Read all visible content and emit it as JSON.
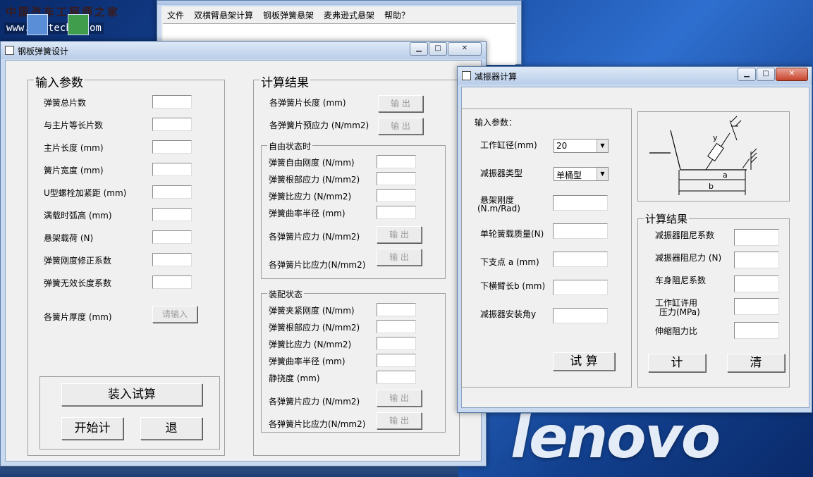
{
  "desktop": {
    "watermark_cn": "中国汽车工程师之家",
    "watermark_url": "www.cartech8.com",
    "brand": "lenovo"
  },
  "main_window": {
    "menu": [
      "文件",
      "双横臂悬架计算",
      "钢板弹簧悬架",
      "麦弗逊式悬架",
      "帮助？"
    ]
  },
  "leaf_spring": {
    "title": "钢板弹簧设计",
    "title_buttons": {
      "min": "▁",
      "max": "□",
      "close": "✕"
    },
    "input_group": {
      "label": "输入参数",
      "fields": [
        "弹簧总片数",
        "与主片等长片数",
        "主片长度    (mm)",
        "簧片宽度    (mm)",
        "U型螺栓加紧距 (mm)",
        "满载时弧高 (mm)",
        "悬架载荷    (N)",
        "弹簧刚度修正系数",
        "弹簧无效长度系数"
      ],
      "thickness_label": "各簧片厚度  (mm)",
      "thickness_button": "请输入"
    },
    "actions": {
      "load_calc": "装入试算",
      "start": "开始计",
      "exit": "退"
    },
    "result_group": {
      "label": "计算结果",
      "len_label": "各弹簧片长度 (mm)",
      "pre_label": "各弹簧片预应力 (N/mm2)",
      "output_label": "输 出",
      "free_state": {
        "label": "自由状态时",
        "fields": [
          "弹簧自由刚度  (N/mm)",
          "弹簧根部应力  (N/mm2)",
          "弹簧比应力    (N/mm2)",
          "弹簧曲率半径  (mm)"
        ],
        "stress_label": "各弹簧片应力 (N/mm2)",
        "ratio_label": "各弹簧片比应力(N/mm2)"
      },
      "assembly_state": {
        "label": "装配状态",
        "fields": [
          "弹簧夹紧刚度  (N/mm)",
          "弹簧根部应力  (N/mm2)",
          "弹簧比应力    (N/mm2)",
          "弹簧曲率半径  (mm)",
          "静挠度        (mm)"
        ],
        "stress_label": "各弹簧片应力 (N/mm2)",
        "ratio_label": "各弹簧片比应力(N/mm2)"
      }
    }
  },
  "damper": {
    "title": "减振器计算",
    "title_buttons": {
      "min": "▁",
      "max": "□",
      "close": "✕"
    },
    "input_label": "输入参数：",
    "cylinder_label": "工作缸径(mm)",
    "cylinder_value": "20",
    "type_label": "减振器类型",
    "type_value": "单桶型",
    "stiffness_label_1": "悬架刚度",
    "stiffness_label_2": "(N.m/Rad)",
    "mass_label": "单轮簧载质量(N)",
    "lower_a_label": "下支点 a    (mm)",
    "arm_b_label": "下横臂长b   (mm)",
    "angle_label": "减振器安装角y",
    "trial_button": "试 算",
    "diagram_labels": {
      "y": "y",
      "a": "a",
      "b": "b"
    },
    "results": {
      "label": "计算结果",
      "damping_coef": "减振器阻尼系数",
      "damping_force": "减振器阻尼力  (N)",
      "body_damping": "车身阻尼系数",
      "pressure_1": "工作缸许用",
      "pressure_2": "压力(MPa)",
      "ratio": "伸缩阻力比",
      "calc_button": "计",
      "clear_button": "清"
    }
  }
}
